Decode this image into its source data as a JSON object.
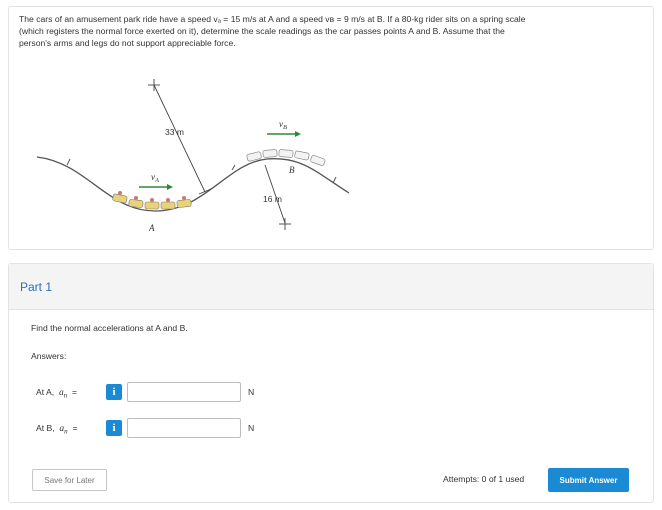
{
  "problem": {
    "line1": "The cars of an amusement park ride have a speed vₐ = 15 m/s at A and a speed vʙ = 9 m/s at B. If a 80-kg rider sits on a spring scale",
    "line2": "(which registers the normal force exerted on it), determine the scale readings as the car passes points A and B. Assume that the",
    "line3": "person's arms and legs do not support appreciable force."
  },
  "figure": {
    "radius_a_label": "33 m",
    "radius_b_label": "16 m",
    "va_label": "v",
    "va_sub": "A",
    "vb_label": "v",
    "vb_sub": "B",
    "point_a_label": "A",
    "point_b_label": "B",
    "arrow_color": "#2a8a3a"
  },
  "part": {
    "title": "Part 1",
    "question": "Find the normal accelerations at A and B.",
    "answers_label": "Answers:",
    "rows": [
      {
        "point_label": "At A,",
        "symbol": "a",
        "sub": "n",
        "eq": "=",
        "info": "i",
        "value": "",
        "unit": "N"
      },
      {
        "point_label": "At B,",
        "symbol": "a",
        "sub": "n",
        "eq": "=",
        "info": "i",
        "value": "",
        "unit": "N"
      }
    ],
    "save_label": "Save for Later",
    "attempts": "Attempts: 0 of 1 used",
    "submit_label": "Submit Answer"
  },
  "colors": {
    "accent": "#1a8ad4",
    "part_title": "#2a6ebb",
    "border": "#e3e3e3"
  }
}
